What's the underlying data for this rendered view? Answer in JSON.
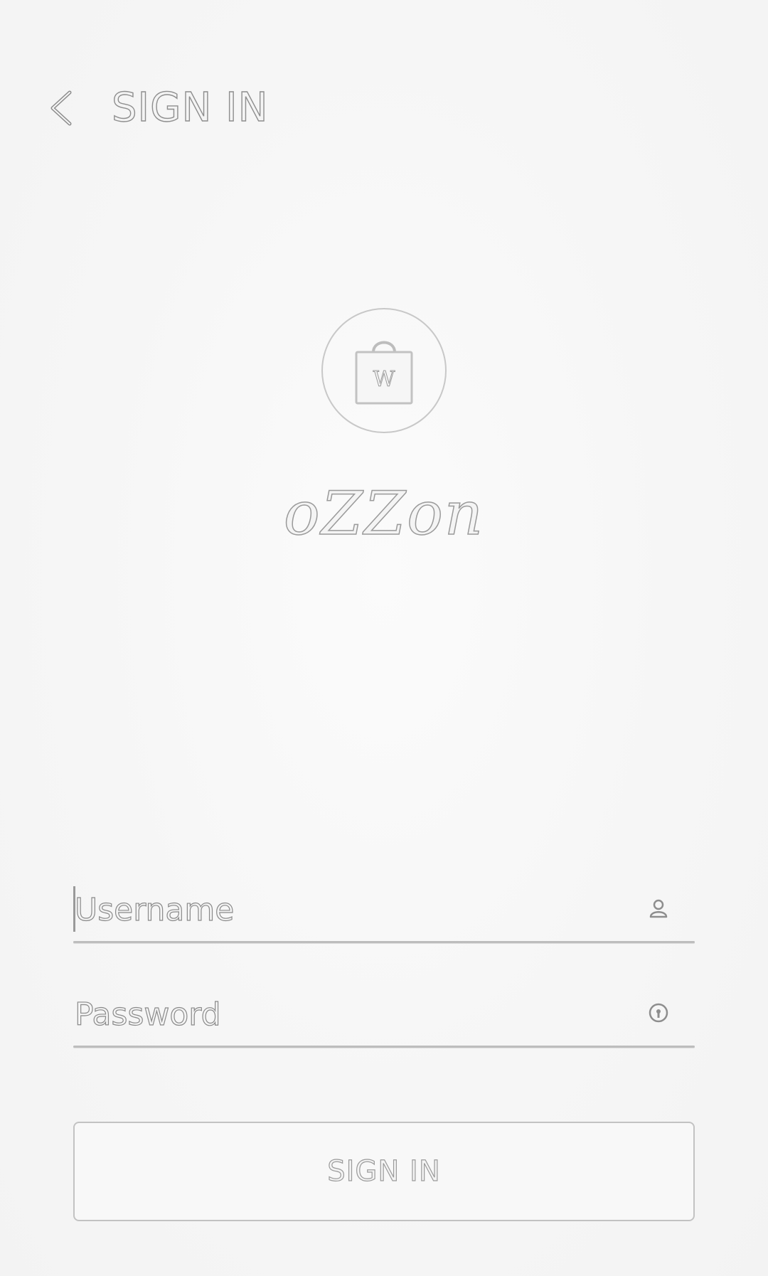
{
  "header": {
    "back_icon": "chevron-left-icon",
    "title": "SIGN IN"
  },
  "logo": {
    "icon": "shopping-bag-icon",
    "bag_letter": "W",
    "wordmark": "oZZon"
  },
  "form": {
    "username": {
      "placeholder": "Username",
      "value": "",
      "icon": "user-icon"
    },
    "password": {
      "placeholder": "Password",
      "value": "",
      "icon": "lock-icon"
    },
    "submit_label": "SIGN IN"
  },
  "colors": {
    "background": "#f7f7f7",
    "outline": "#8e8e8e",
    "divider": "#bdbdbd"
  }
}
